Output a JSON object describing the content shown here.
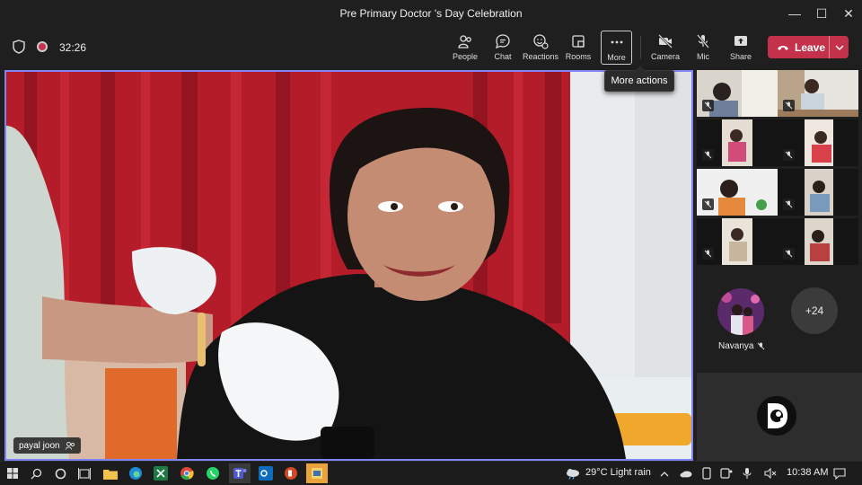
{
  "window": {
    "title": "Pre Primary Doctor 's Day Celebration"
  },
  "meeting": {
    "timer": "32:26",
    "toolbar": {
      "people": "People",
      "chat": "Chat",
      "reactions": "Reactions",
      "rooms": "Rooms",
      "more": "More",
      "camera": "Camera",
      "mic": "Mic",
      "share": "Share",
      "leave": "Leave"
    },
    "tooltip": "More actions",
    "main_video": {
      "participant_name": "payal joon"
    },
    "gallery": {
      "named_participant": "Navanya",
      "overflow_count": "+24"
    }
  },
  "taskbar": {
    "weather": "29°C  Light rain",
    "time": "10:38 AM"
  },
  "colors": {
    "accent": "#7f85f5",
    "leave": "#c4314b",
    "background": "#1f1f1f"
  }
}
